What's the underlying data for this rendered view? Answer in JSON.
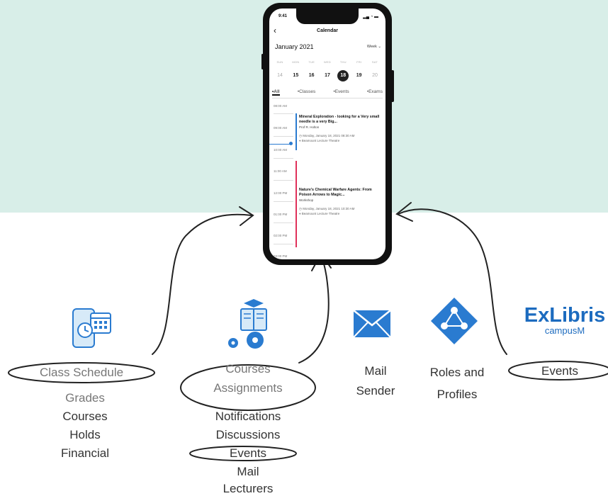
{
  "phone": {
    "status_time": "9:41",
    "screen_title": "Calendar",
    "month": "January 2021",
    "view_selector": "Week ⌄",
    "week_days": [
      {
        "name": "SUN",
        "date": "14"
      },
      {
        "name": "MON",
        "date": "15"
      },
      {
        "name": "TUE",
        "date": "16"
      },
      {
        "name": "WED",
        "date": "17"
      },
      {
        "name": "THU",
        "date": "18"
      },
      {
        "name": "FRI",
        "date": "19"
      },
      {
        "name": "SAT",
        "date": "20"
      }
    ],
    "filters": {
      "all": "All",
      "classes": "Classes",
      "events": "Events",
      "exams": "Exams"
    },
    "times": [
      "08:00 AM",
      "09:00 AM",
      "10:00 AM",
      "11:00 AM",
      "12:00 PM",
      "01:00 PM",
      "02:00 PM",
      "03:00 PM"
    ],
    "events": [
      {
        "title": "Mineral Exploration - looking for a Very small needle is a very Big...",
        "subtitle": "Prof R. Holton",
        "datetime": "Monday, January 18, 2021 08:30 AM",
        "location": "Beamount Lecture Theatre",
        "color": "#2a7bd0"
      },
      {
        "title": "Nature's Chemical Warfare Agents: From Poison Arrows to Magic...",
        "subtitle": "Workshop",
        "datetime": "Monday, January 18, 2021 10:30 AM",
        "location": "Beamount Lecture Theatre",
        "color": "#e0305a"
      }
    ]
  },
  "sources": {
    "class_schedule": {
      "label": "Class Schedule",
      "items": [
        "Grades",
        "Courses",
        "Holds",
        "Financial"
      ]
    },
    "courses": {
      "label_line1": "Courses",
      "label_line2": "Assignments",
      "items": [
        "Notifications",
        "Discussions",
        "Events",
        "Mail",
        "Lecturers"
      ]
    },
    "mail": {
      "line1": "Mail",
      "line2": "Sender"
    },
    "roles": {
      "line1": "Roles and",
      "line2": "Profiles"
    },
    "exlibris": {
      "brand": "ExLibris",
      "product": "campusM",
      "label": "Events"
    }
  },
  "colors": {
    "background_top": "#d8eee8",
    "icon_blue": "#2a7bd0",
    "brand_blue": "#1c6bbf"
  }
}
